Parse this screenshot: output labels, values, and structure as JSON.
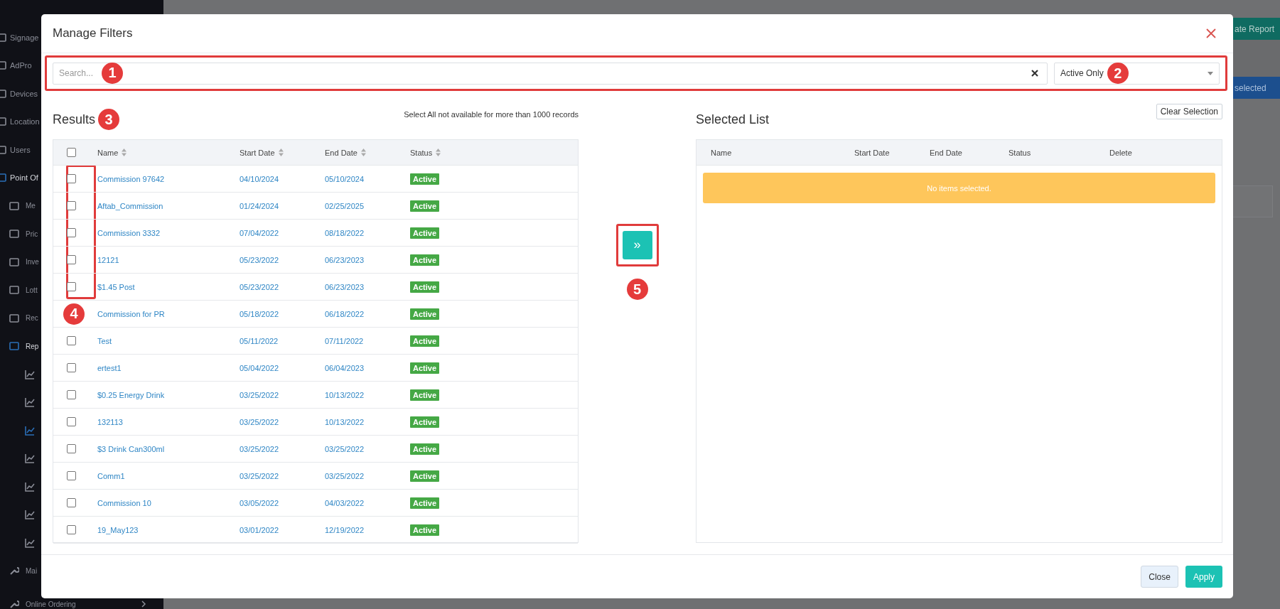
{
  "sidebar": {
    "items": [
      {
        "label": "Signage",
        "kind": "top",
        "selected": false
      },
      {
        "label": "AdPro",
        "kind": "top",
        "selected": false
      },
      {
        "label": "Devices",
        "kind": "top",
        "selected": false
      },
      {
        "label": "Location",
        "kind": "top",
        "selected": false
      },
      {
        "label": "Users",
        "kind": "top",
        "selected": false
      },
      {
        "label": "Point Of",
        "kind": "top",
        "selected": true
      },
      {
        "label": "Me",
        "kind": "sub",
        "selected": false
      },
      {
        "label": "Pric",
        "kind": "sub",
        "selected": false
      },
      {
        "label": "Inve",
        "kind": "sub",
        "selected": false
      },
      {
        "label": "Lott",
        "kind": "sub",
        "selected": false
      },
      {
        "label": "Rec",
        "kind": "sub",
        "selected": false
      },
      {
        "label": "Rep",
        "kind": "sub",
        "selected": true
      }
    ],
    "sub_items": [
      {
        "selected": false
      },
      {
        "selected": false
      },
      {
        "selected": true
      },
      {
        "selected": false
      },
      {
        "selected": false
      },
      {
        "selected": false
      },
      {
        "selected": false
      }
    ],
    "bottom_items": [
      {
        "label": "Mai",
        "expandable": false
      },
      {
        "label": "Online Ordering",
        "expandable": true
      }
    ]
  },
  "page": {
    "buttons": [
      "ate Report",
      "selected"
    ]
  },
  "modal": {
    "title": "Manage Filters",
    "search": {
      "placeholder": "Search...",
      "marker": "1"
    },
    "status_filter": {
      "value": "Active Only",
      "marker": "2"
    },
    "results": {
      "title": "Results",
      "marker": "3",
      "note": "Select All not available for more than 1000 records",
      "select_all": {
        "checked": false
      },
      "columns": [
        "Name",
        "Start Date",
        "End Date",
        "Status"
      ],
      "rows": [
        {
          "checked": false,
          "name": "Commission 97642",
          "start": "04/10/2024",
          "end": "05/10/2024",
          "status": "Active"
        },
        {
          "checked": false,
          "name": "Aftab_Commission",
          "start": "01/24/2024",
          "end": "02/25/2025",
          "status": "Active"
        },
        {
          "checked": false,
          "name": "Commission 3332",
          "start": "07/04/2022",
          "end": "08/18/2022",
          "status": "Active"
        },
        {
          "checked": false,
          "name": "12121",
          "start": "05/23/2022",
          "end": "06/23/2023",
          "status": "Active"
        },
        {
          "checked": false,
          "name": "$1.45 Post",
          "start": "05/23/2022",
          "end": "06/23/2023",
          "status": "Active"
        },
        {
          "marker": "4",
          "name": "Commission for PR",
          "start": "05/18/2022",
          "end": "06/18/2022",
          "status": "Active"
        },
        {
          "checked": false,
          "name": "Test",
          "start": "05/11/2022",
          "end": "07/11/2022",
          "status": "Active"
        },
        {
          "checked": false,
          "name": "ertest1",
          "start": "05/04/2022",
          "end": "06/04/2023",
          "status": "Active"
        },
        {
          "checked": false,
          "name": "$0.25 Energy Drink",
          "start": "03/25/2022",
          "end": "10/13/2022",
          "status": "Active"
        },
        {
          "checked": false,
          "name": "132113",
          "start": "03/25/2022",
          "end": "10/13/2022",
          "status": "Active"
        },
        {
          "checked": false,
          "name": "$3 Drink Can300ml",
          "start": "03/25/2022",
          "end": "03/25/2022",
          "status": "Active"
        },
        {
          "checked": false,
          "name": "Comm1",
          "start": "03/25/2022",
          "end": "03/25/2022",
          "status": "Active"
        },
        {
          "checked": false,
          "name": "Commission 10",
          "start": "03/05/2022",
          "end": "04/03/2022",
          "status": "Active"
        },
        {
          "checked": false,
          "name": "19_May123",
          "start": "03/01/2022",
          "end": "12/19/2022",
          "status": "Active"
        }
      ]
    },
    "move_button": {
      "label": "»",
      "marker": "5"
    },
    "selected_list": {
      "title": "Selected List",
      "clear_button": "Clear Selection",
      "columns": [
        "Name",
        "Start Date",
        "End Date",
        "Status",
        "Delete"
      ],
      "empty_message": "No items selected."
    },
    "footer": {
      "buttons": [
        {
          "label": "Close",
          "kind": "secondary"
        },
        {
          "label": "Apply",
          "kind": "primary"
        }
      ]
    }
  }
}
